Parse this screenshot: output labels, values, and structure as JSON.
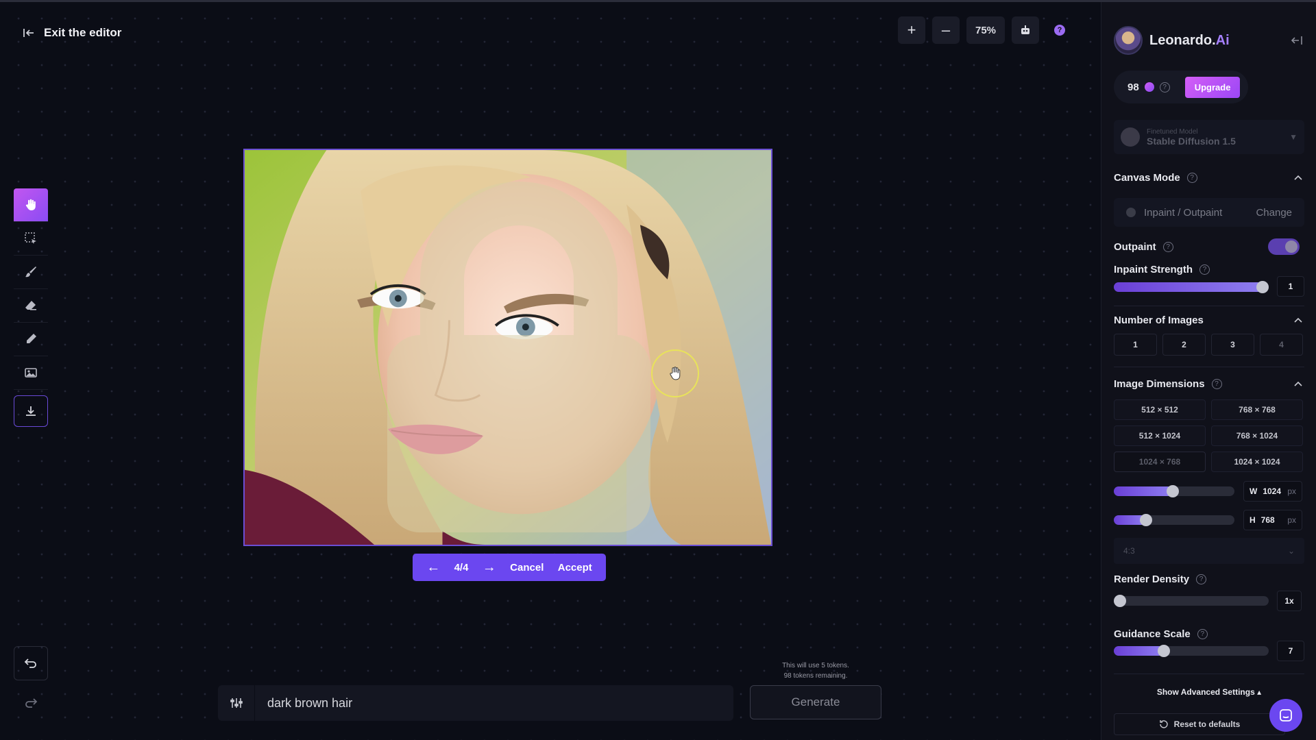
{
  "editor": {
    "exit_label": "Exit the editor"
  },
  "zoom": {
    "zoom_in": "+",
    "zoom_out": "–",
    "level": "75%",
    "help": "?"
  },
  "tools": [
    "hand-icon",
    "select-icon",
    "brush-icon",
    "eraser-icon",
    "pencil-icon",
    "image-icon",
    "download-icon"
  ],
  "pager": {
    "position": "4/4",
    "prev": "←",
    "next": "→",
    "cancel_label": "Cancel",
    "accept_label": "Accept"
  },
  "prompt": {
    "value": "dark brown hair",
    "token_note_line1": "This will use 5 tokens.",
    "token_note_line2": "98 tokens remaining.",
    "generate_label": "Generate"
  },
  "panel": {
    "brand": {
      "name": "Leonardo.",
      "suffix": "Ai"
    },
    "tokens": {
      "count": "98",
      "upgrade_label": "Upgrade"
    },
    "model": {
      "label": "Finetuned Model",
      "value": "Stable Diffusion 1.5"
    },
    "canvas_mode": {
      "title": "Canvas Mode",
      "mode": "Inpaint / Outpaint",
      "change_label": "Change"
    },
    "outpaint": {
      "title": "Outpaint",
      "enabled": true
    },
    "inpaint_strength": {
      "title": "Inpaint Strength",
      "value": "1",
      "fraction": 1.0
    },
    "number_of_images": {
      "title": "Number of Images",
      "options": [
        "1",
        "2",
        "3",
        "4"
      ],
      "selected": "4"
    },
    "image_dimensions": {
      "title": "Image Dimensions",
      "options": [
        "512 × 512",
        "768 × 768",
        "512 × 1024",
        "768 × 1024",
        "1024 × 768",
        "1024 × 1024"
      ],
      "selected": "1024 × 768",
      "width_label": "W",
      "width": "1024",
      "height_label": "H",
      "height": "768",
      "unit": "px",
      "width_fraction": 0.49,
      "height_fraction": 0.24,
      "aspect": "4:3"
    },
    "render_density": {
      "title": "Render Density",
      "value": "1x",
      "fraction": 0.0
    },
    "guidance_scale": {
      "title": "Guidance Scale",
      "value": "7",
      "fraction": 0.31
    },
    "advanced_label": "Show Advanced Settings",
    "reset_label": "Reset to defaults"
  },
  "colors": {
    "accent": "#6b47f0",
    "gradient_start": "#c256f0",
    "gradient_end": "#8a4cf3",
    "background": "#0b0d16",
    "panel": "#10111a"
  }
}
